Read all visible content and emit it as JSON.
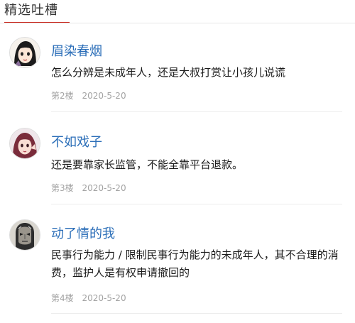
{
  "section": {
    "title": "精选吐槽"
  },
  "comments": [
    {
      "nickname": "眉染春烟",
      "content": "怎么分辨是未成年人，还是大叔打赏让小孩儿说谎",
      "floor": "第2楼",
      "date": "2020-5-20"
    },
    {
      "nickname": "不如戏子",
      "content": "还是要靠家长监管，不能全靠平台退款。",
      "floor": "第3楼",
      "date": "2020-5-20"
    },
    {
      "nickname": "动了情的我",
      "content": "民事行为能力 / 限制民事行为能力的未成年人，其不合理的消费，监护人是有权申请撤回的",
      "floor": "第4楼",
      "date": "2020-5-20"
    }
  ],
  "colors": {
    "nickname": "#2b6eb8",
    "accent_underline": "#c8281e",
    "meta": "#a3a3a3"
  }
}
